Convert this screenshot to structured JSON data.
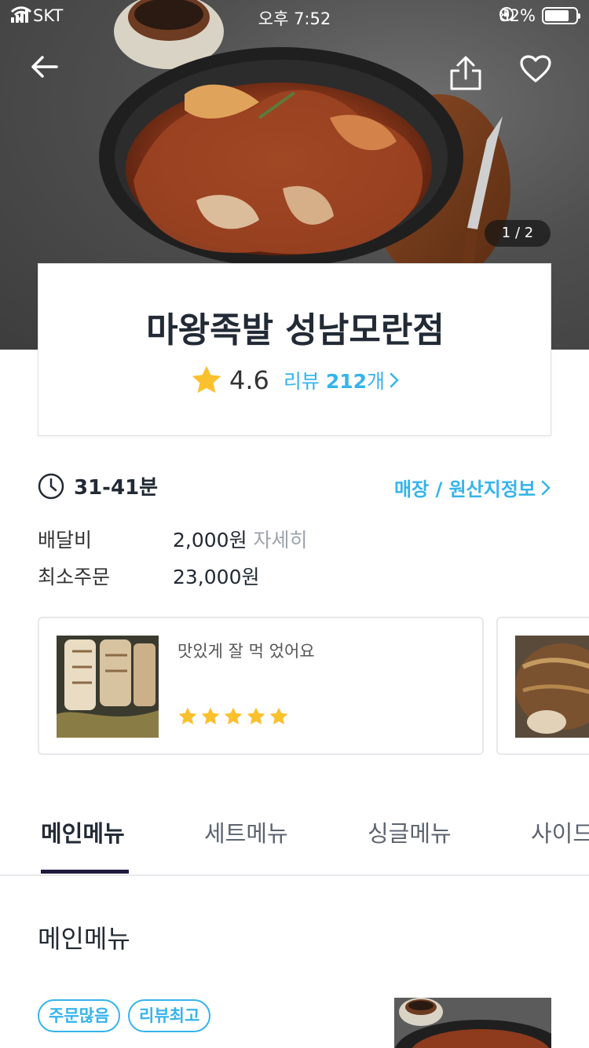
{
  "status_bar": {
    "carrier": "SKT",
    "time": "오후 7:52",
    "battery": "82%",
    "battery_level": 0.82
  },
  "hero": {
    "image_counter": "1 / 2"
  },
  "restaurant": {
    "name": "마왕족발 성남모란점",
    "rating": "4.6",
    "review_prefix": "리뷰",
    "review_count": "212",
    "review_suffix": "개"
  },
  "info": {
    "delivery_time": "31-41분",
    "store_info_link": "매장 / 원산지정보",
    "delivery_fee_label": "배달비",
    "delivery_fee_value": "2,000원",
    "delivery_fee_detail": "자세히",
    "min_order_label": "최소주문",
    "min_order_value": "23,000원"
  },
  "reviews": [
    {
      "text": "맛있게 잘 먹 었어요",
      "stars": 5
    }
  ],
  "tabs": [
    {
      "label": "메인메뉴",
      "active": true
    },
    {
      "label": "세트메뉴",
      "active": false
    },
    {
      "label": "싱글메뉴",
      "active": false
    },
    {
      "label": "사이드",
      "active": false
    }
  ],
  "section": {
    "title": "메인메뉴"
  },
  "badges": [
    "주문많음",
    "리뷰최고"
  ],
  "colors": {
    "accent": "#35b4ec",
    "star": "#fbc02d",
    "tab_indicator": "#1f1a3f"
  },
  "icons": [
    "back-arrow-icon",
    "share-icon",
    "heart-icon",
    "star-icon",
    "clock-icon",
    "chevron-right-icon"
  ]
}
